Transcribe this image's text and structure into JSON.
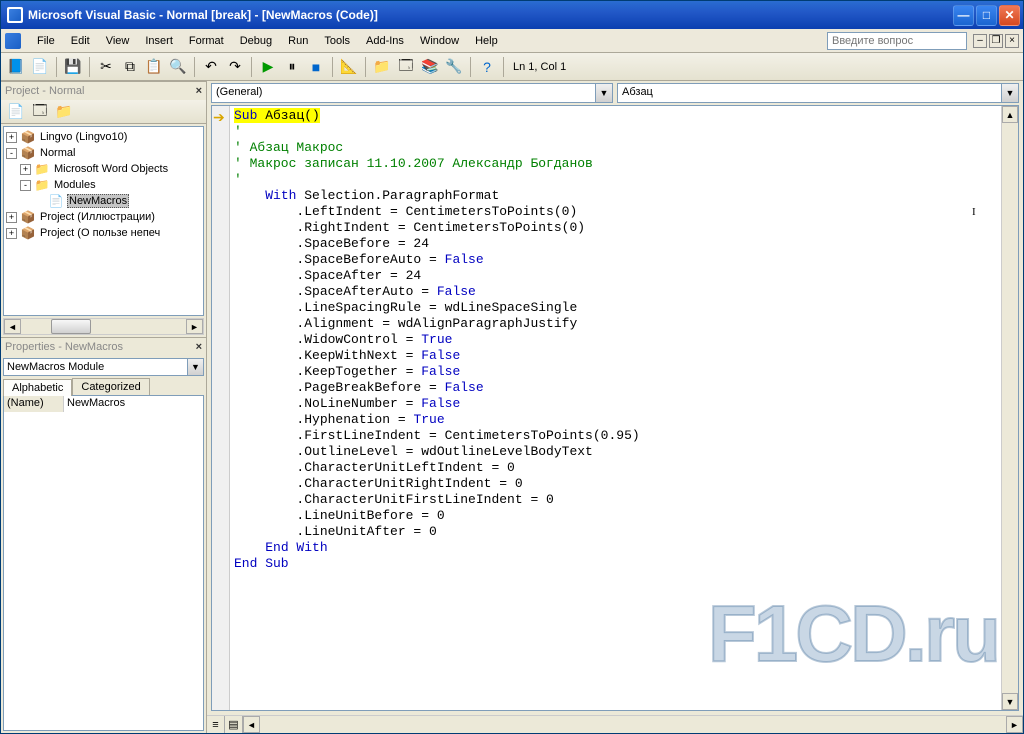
{
  "title": "Microsoft Visual Basic - Normal [break] - [NewMacros (Code)]",
  "menu": [
    "File",
    "Edit",
    "View",
    "Insert",
    "Format",
    "Debug",
    "Run",
    "Tools",
    "Add-Ins",
    "Window",
    "Help"
  ],
  "search_placeholder": "Введите вопрос",
  "toolbar_status": "Ln 1, Col 1",
  "project_panel": {
    "title": "Project - Normal",
    "tree": [
      {
        "type": "proj",
        "exp": "+",
        "indent": 0,
        "label": "Lingvo (Lingvo10)"
      },
      {
        "type": "proj",
        "exp": "-",
        "indent": 0,
        "label": "Normal"
      },
      {
        "type": "folder",
        "exp": "+",
        "indent": 1,
        "label": "Microsoft Word Objects"
      },
      {
        "type": "folder",
        "exp": "-",
        "indent": 1,
        "label": "Modules"
      },
      {
        "type": "module",
        "exp": "",
        "indent": 2,
        "label": "NewMacros",
        "selected": true
      },
      {
        "type": "proj",
        "exp": "+",
        "indent": 0,
        "label": "Project (Иллюстрации)"
      },
      {
        "type": "proj",
        "exp": "+",
        "indent": 0,
        "label": "Project (О пользе непеч"
      }
    ]
  },
  "properties_panel": {
    "title": "Properties - NewMacros",
    "object": "NewMacros",
    "object_type": "Module",
    "tabs": [
      "Alphabetic",
      "Categorized"
    ],
    "active_tab": 0,
    "rows": [
      {
        "name": "(Name)",
        "value": "NewMacros"
      }
    ]
  },
  "combos": {
    "left": "(General)",
    "right": "Абзац"
  },
  "code": {
    "sub_decl": "Sub Абзац()",
    "comments": [
      "'",
      "' Абзац Макрос",
      "' Макрос записан 11.10.2007 Александр Богданов",
      "'"
    ],
    "with_open": "    With Selection.ParagraphFormat",
    "lines": [
      "        .LeftIndent = CentimetersToPoints(0)",
      "        .RightIndent = CentimetersToPoints(0)",
      "        .SpaceBefore = 24",
      "        .SpaceBeforeAuto = False",
      "        .SpaceAfter = 24",
      "        .SpaceAfterAuto = False",
      "        .LineSpacingRule = wdLineSpaceSingle",
      "        .Alignment = wdAlignParagraphJustify",
      "        .WidowControl = True",
      "        .KeepWithNext = False",
      "        .KeepTogether = False",
      "        .PageBreakBefore = False",
      "        .NoLineNumber = False",
      "        .Hyphenation = True",
      "        .FirstLineIndent = CentimetersToPoints(0.95)",
      "        .OutlineLevel = wdOutlineLevelBodyText",
      "        .CharacterUnitLeftIndent = 0",
      "        .CharacterUnitRightIndent = 0",
      "        .CharacterUnitFirstLineIndent = 0",
      "        .LineUnitBefore = 0",
      "        .LineUnitAfter = 0"
    ],
    "with_close": "    End With",
    "sub_end": "End Sub"
  },
  "watermark": "F1CD.ru"
}
